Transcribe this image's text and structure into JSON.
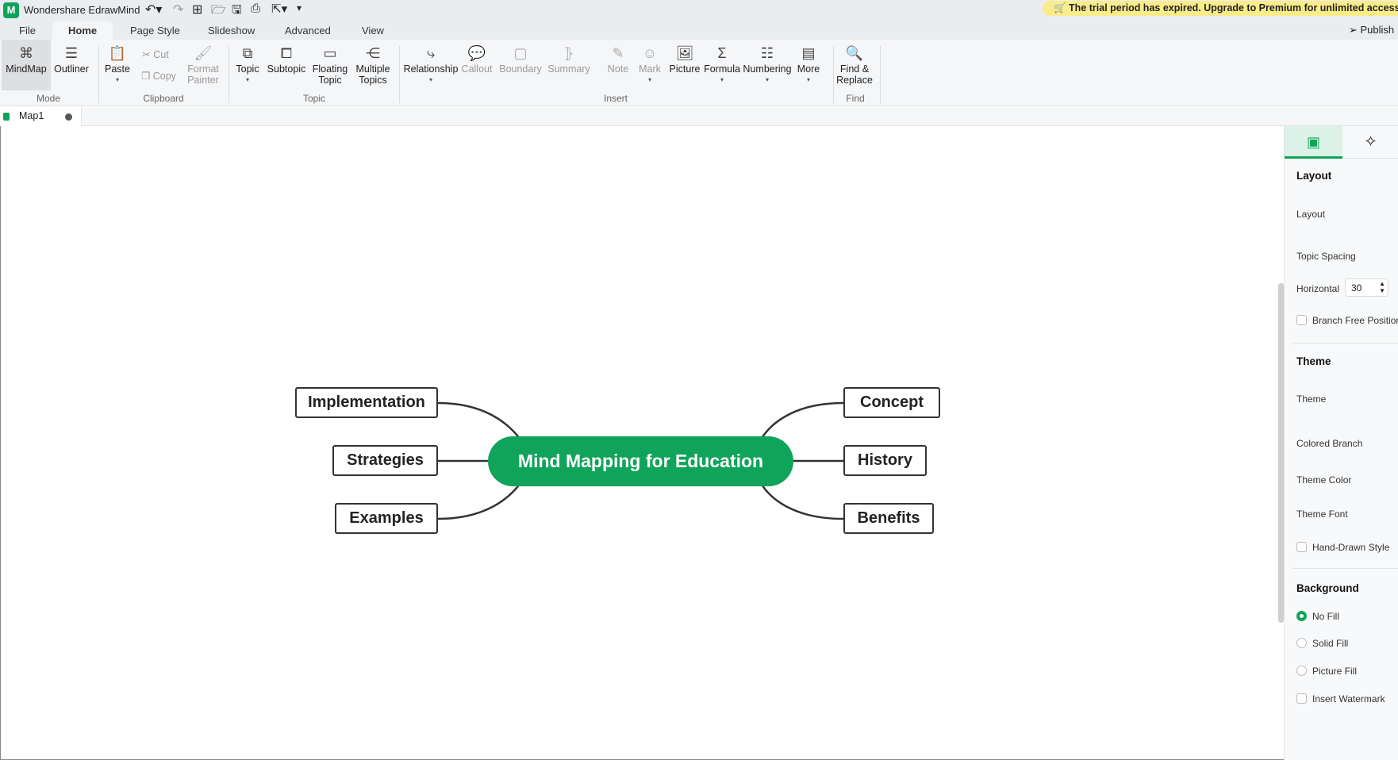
{
  "app": {
    "title": "Wondershare EdrawMind",
    "trial_banner": "The trial period has expired. Upgrade to Premium for unlimited access.",
    "publish": "Publish"
  },
  "menu_tabs": [
    "File",
    "Home",
    "Page Style",
    "Slideshow",
    "Advanced",
    "View"
  ],
  "ribbon": {
    "buttons": {
      "mindmap": "MindMap",
      "outliner": "Outliner",
      "paste": "Paste",
      "cut": "Cut",
      "copy": "Copy",
      "format_painter_1": "Format",
      "format_painter_2": "Painter",
      "topic": "Topic",
      "subtopic": "Subtopic",
      "floating_1": "Floating",
      "floating_2": "Topic",
      "multiple_1": "Multiple",
      "multiple_2": "Topics",
      "relationship": "Relationship",
      "callout": "Callout",
      "boundary": "Boundary",
      "summary": "Summary",
      "note": "Note",
      "mark": "Mark",
      "picture": "Picture",
      "formula": "Formula",
      "numbering": "Numbering",
      "more": "More",
      "find_1": "Find &",
      "find_2": "Replace"
    },
    "groups": {
      "mode": "Mode",
      "clipboard": "Clipboard",
      "topic": "Topic",
      "insert": "Insert",
      "find": "Find"
    }
  },
  "document_tab": {
    "name": "Map1"
  },
  "mindmap": {
    "central": "Mind Mapping for Education",
    "central_color": "#10a35a",
    "left": [
      "Implementation",
      "Strategies",
      "Examples"
    ],
    "right": [
      "Concept",
      "History",
      "Benefits"
    ]
  },
  "panel": {
    "layout_heading": "Layout",
    "layout": "Layout",
    "topic_spacing": "Topic Spacing",
    "horizontal": "Horizontal",
    "horizontal_value": "30",
    "branch_free": "Branch Free Position",
    "theme_heading": "Theme",
    "theme": "Theme",
    "colored_branch": "Colored Branch",
    "theme_color": "Theme Color",
    "theme_font": "Theme Font",
    "hand_drawn": "Hand-Drawn Style",
    "background_heading": "Background",
    "no_fill": "No Fill",
    "solid_fill": "Solid Fill",
    "picture_fill": "Picture Fill",
    "insert_watermark": "Insert Watermark",
    "background_selected": "No Fill",
    "accent": "#10a35a"
  }
}
